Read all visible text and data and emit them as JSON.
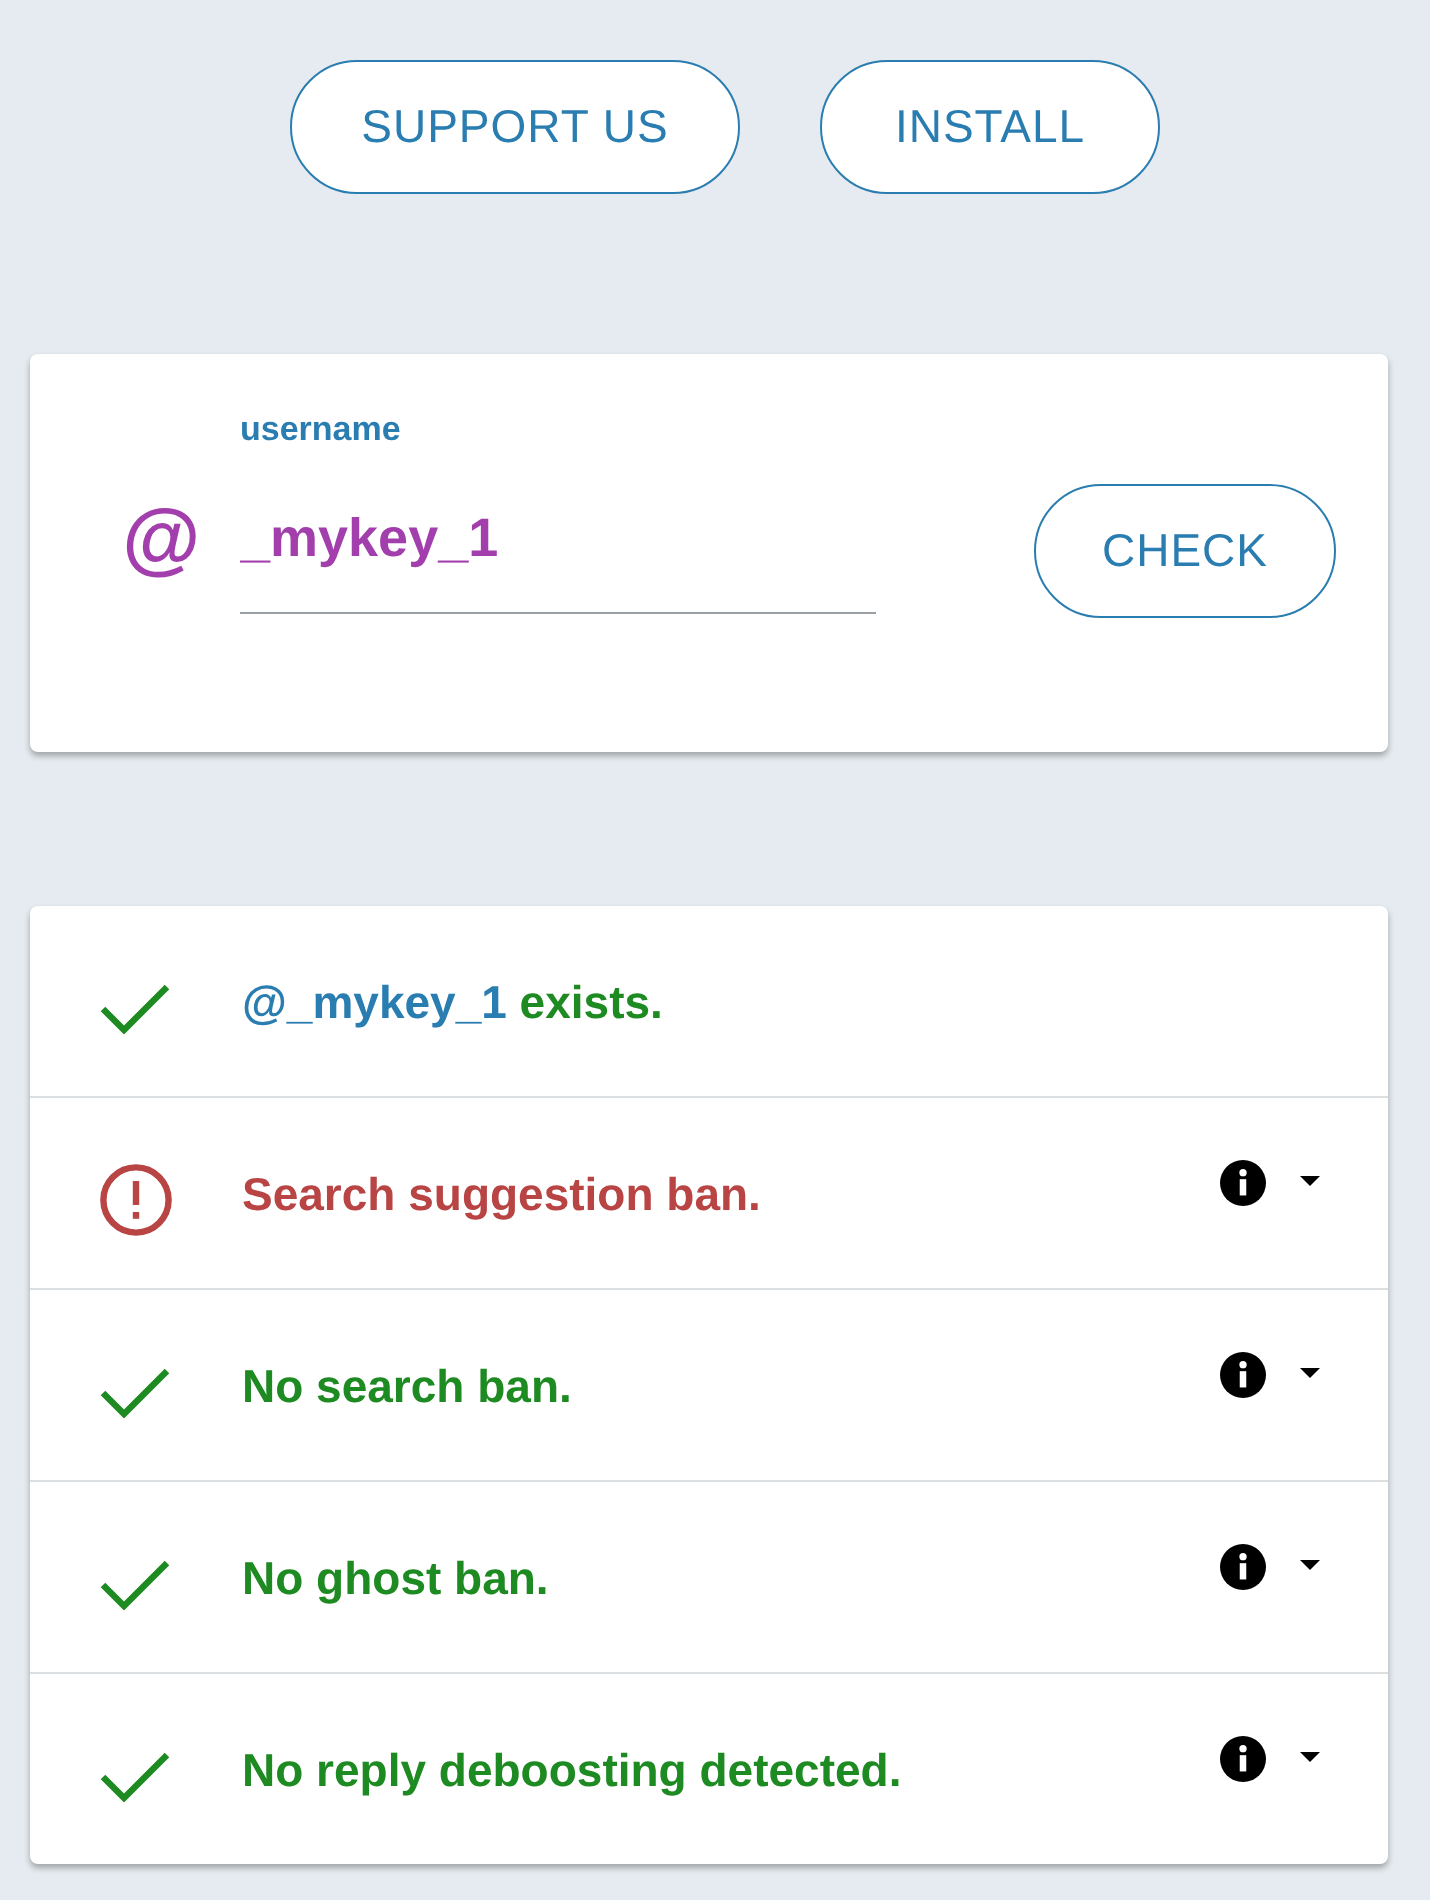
{
  "header": {
    "buttons": [
      "SUPPORT US",
      "INSTALL"
    ]
  },
  "search_card": {
    "prefix": "@",
    "label": "username",
    "value": "_mykey_1",
    "button": "CHECK"
  },
  "results": [
    {
      "kind": "ok",
      "handle": "@_mykey_1",
      "text": "exists.",
      "details": false
    },
    {
      "kind": "ban",
      "text": "Search suggestion ban.",
      "details": true
    },
    {
      "kind": "ok",
      "text": "No search ban.",
      "details": true
    },
    {
      "kind": "ok",
      "text": "No ghost ban.",
      "details": true
    },
    {
      "kind": "ok",
      "text": "No reply deboosting detected.",
      "details": true
    }
  ]
}
